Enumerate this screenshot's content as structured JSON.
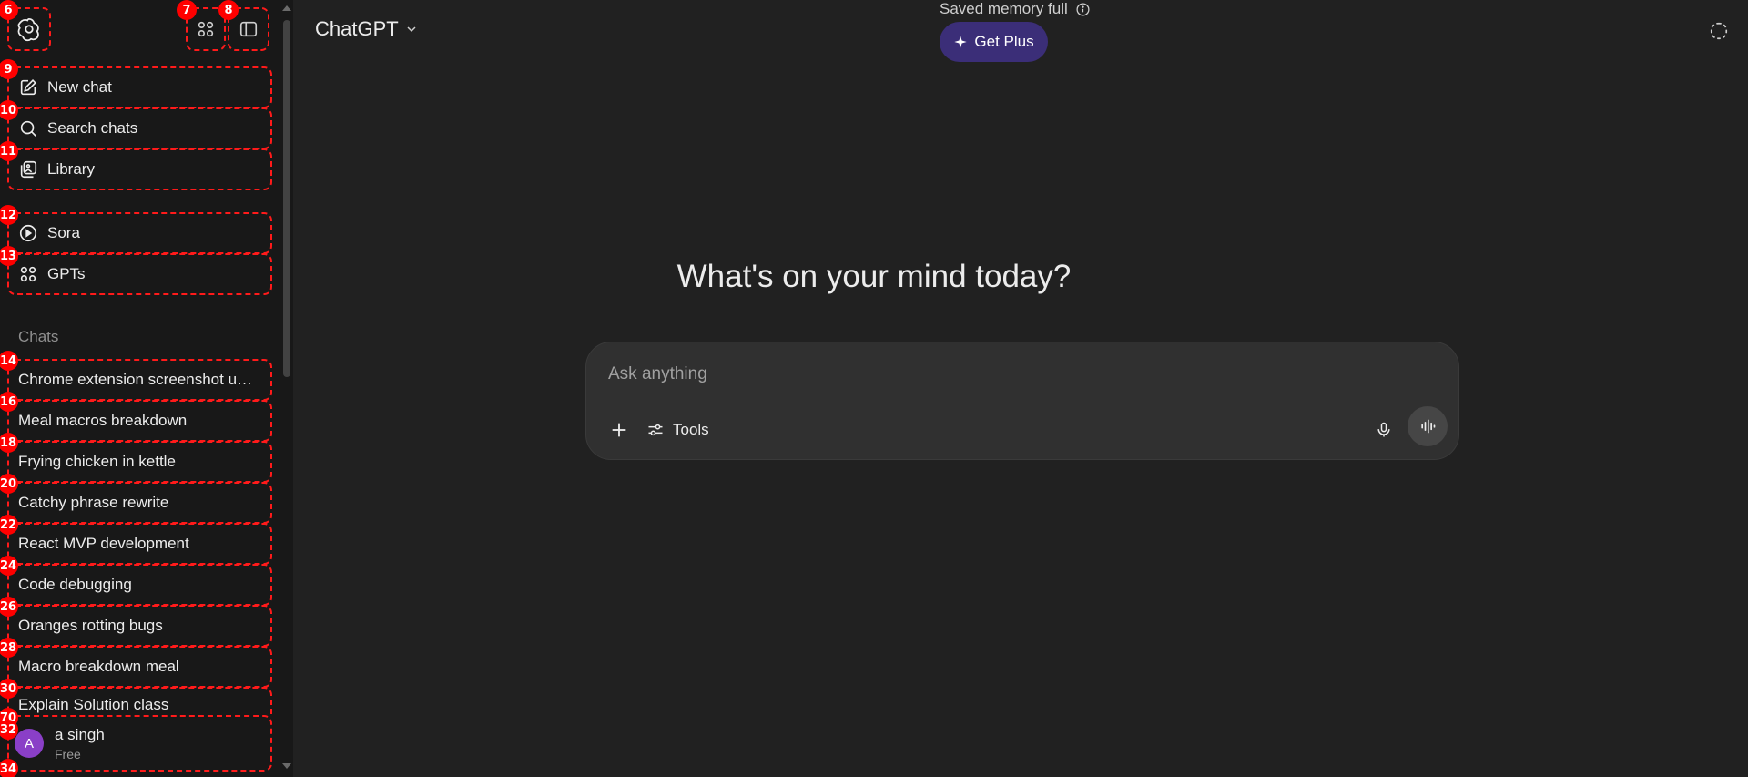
{
  "sidebar": {
    "badges": {
      "logo": "6",
      "apps": "7",
      "toggle": "8",
      "new_chat": "9",
      "search": "10",
      "library": "11",
      "sora": "12",
      "gpts": "13",
      "chats": [
        "14",
        "16",
        "18",
        "20",
        "22",
        "24",
        "26",
        "28",
        "30"
      ],
      "overlap": "70",
      "profile": "32",
      "bottom": "34"
    },
    "nav": {
      "new_chat": "New chat",
      "search": "Search chats",
      "library": "Library",
      "sora": "Sora",
      "gpts": "GPTs"
    },
    "chats_heading": "Chats",
    "chats": [
      "Chrome extension screenshot u…",
      "Meal macros breakdown",
      "Frying chicken in kettle",
      "Catchy phrase rewrite",
      "React MVP development",
      "Code debugging",
      "Oranges rotting bugs",
      "Macro breakdown meal",
      "Explain Solution class"
    ],
    "user": {
      "avatar_letter": "A",
      "name": "a singh",
      "plan": "Free",
      "avatar_color": "#8a3fc7"
    }
  },
  "header": {
    "model": "ChatGPT",
    "memory_note": "Saved memory full",
    "get_plus": "Get Plus",
    "get_plus_color": "#3b2e78"
  },
  "main": {
    "headline": "What's on your mind today?",
    "composer": {
      "placeholder": "Ask anything",
      "tools_label": "Tools"
    }
  },
  "icons": {
    "logo": "openai-logo-icon",
    "apps": "grid-icon",
    "toggle": "sidebar-toggle-icon",
    "new_chat": "edit-icon",
    "search": "search-icon",
    "library": "library-icon",
    "sora": "play-circle-icon",
    "gpts": "grid-icon",
    "info": "info-icon",
    "sparkle": "sparkle-icon",
    "temp_chat": "dashed-circle-icon",
    "plus": "plus-icon",
    "tools": "sliders-icon",
    "mic": "mic-icon",
    "voice": "waveform-icon"
  }
}
